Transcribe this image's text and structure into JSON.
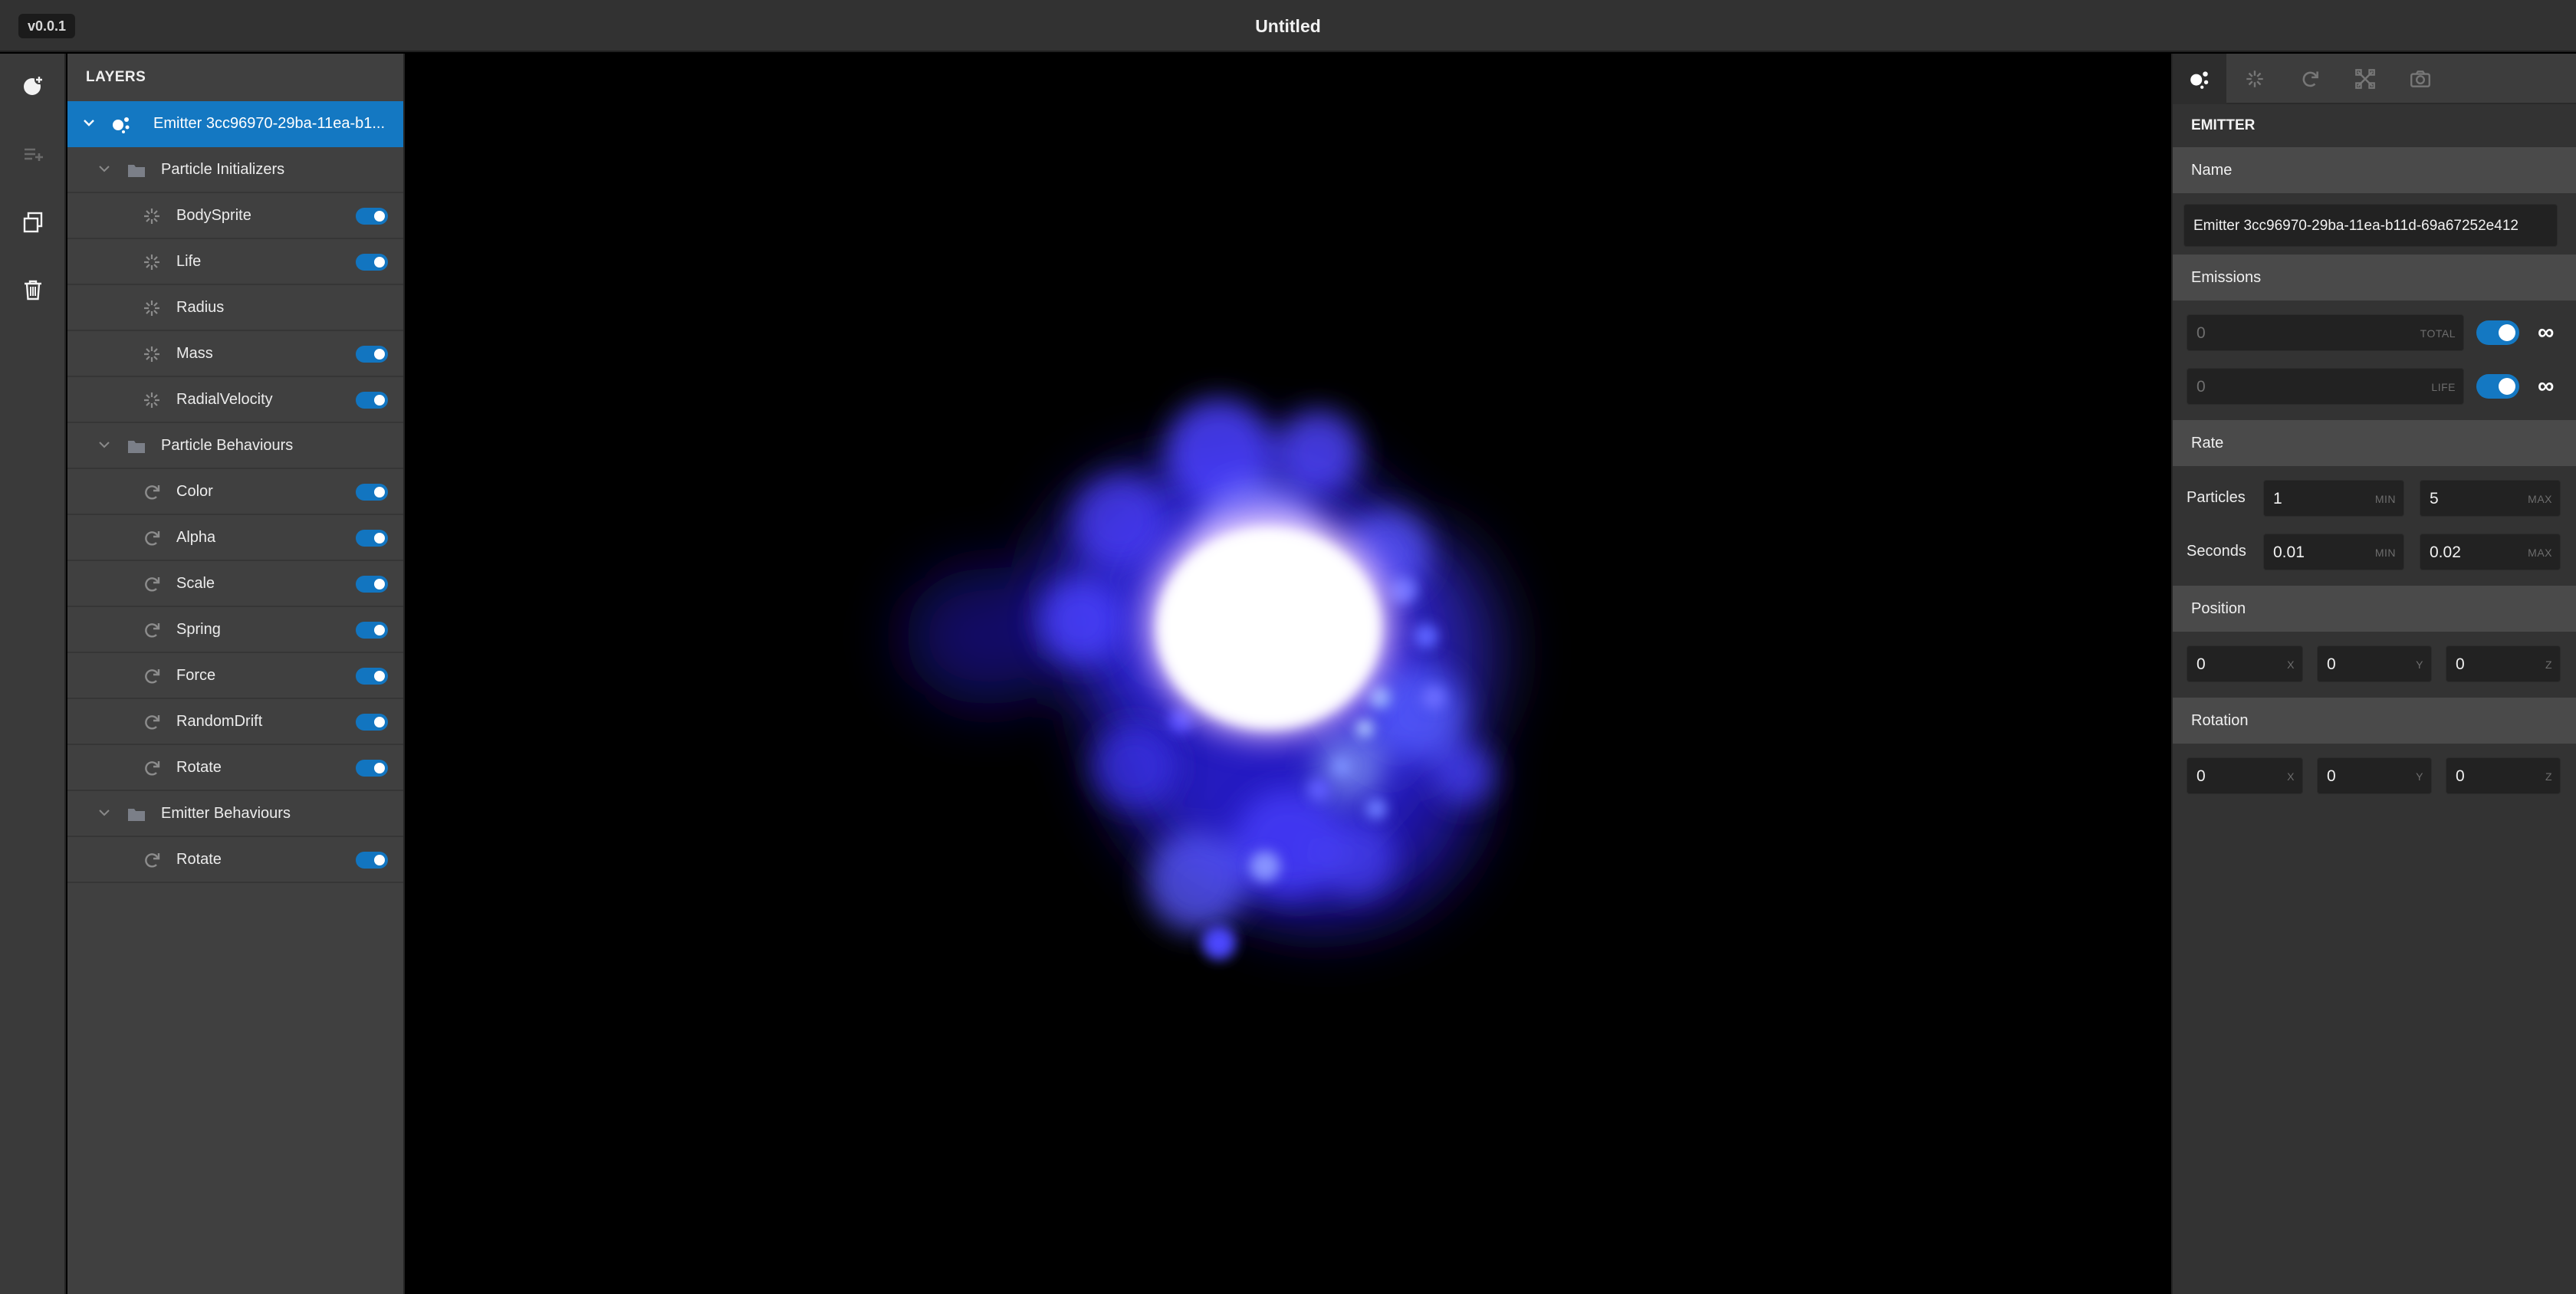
{
  "app": {
    "version": "v0.0.1",
    "title": "Untitled"
  },
  "toolbar": {
    "items": [
      {
        "icon": "add-emitter-icon"
      },
      {
        "icon": "add-behaviour-icon"
      },
      {
        "icon": "duplicate-icon"
      },
      {
        "icon": "delete-icon"
      }
    ]
  },
  "layers": {
    "title": "LAYERS",
    "emitter": {
      "label": "Emitter 3cc96970-29ba-11ea-b1..."
    },
    "groups": [
      {
        "label": "Particle Initializers",
        "items": [
          {
            "label": "BodySprite",
            "enabled": true
          },
          {
            "label": "Life",
            "enabled": true
          },
          {
            "label": "Radius",
            "enabled": false
          },
          {
            "label": "Mass",
            "enabled": true
          },
          {
            "label": "RadialVelocity",
            "enabled": true
          }
        ]
      },
      {
        "label": "Particle Behaviours",
        "items": [
          {
            "label": "Color",
            "enabled": true
          },
          {
            "label": "Alpha",
            "enabled": true
          },
          {
            "label": "Scale",
            "enabled": true
          },
          {
            "label": "Spring",
            "enabled": true
          },
          {
            "label": "Force",
            "enabled": true
          },
          {
            "label": "RandomDrift",
            "enabled": true
          },
          {
            "label": "Rotate",
            "enabled": true
          }
        ]
      },
      {
        "label": "Emitter Behaviours",
        "items": [
          {
            "label": "Rotate",
            "enabled": true
          }
        ]
      }
    ]
  },
  "props": {
    "tabs": [
      "emitter-icon",
      "initializers-icon",
      "behaviours-icon",
      "emitter-behaviours-icon",
      "camera-icon"
    ],
    "heading": "EMITTER",
    "name": {
      "section": "Name",
      "value": "Emitter 3cc96970-29ba-11ea-b11d-69a67252e412"
    },
    "emissions": {
      "section": "Emissions",
      "total": {
        "value": "0",
        "suffix": "TOTAL",
        "infinite": true,
        "symbol": "∞"
      },
      "life": {
        "value": "0",
        "suffix": "LIFE",
        "infinite": true,
        "symbol": "∞"
      }
    },
    "rate": {
      "section": "Rate",
      "particles": {
        "label": "Particles",
        "min": "1",
        "max": "5"
      },
      "seconds": {
        "label": "Seconds",
        "min": "0.01",
        "max": "0.02"
      },
      "min_suffix": "MIN",
      "max_suffix": "MAX"
    },
    "position": {
      "section": "Position",
      "x": "0",
      "y": "0",
      "z": "0"
    },
    "rotation": {
      "section": "Rotation",
      "x": "0",
      "y": "0",
      "z": "0"
    },
    "axis": {
      "x": "X",
      "y": "Y",
      "z": "Z"
    }
  },
  "colors": {
    "accent": "#1478c2",
    "particle_core": "#ffffff",
    "particle_glow": "#4a40ff"
  }
}
